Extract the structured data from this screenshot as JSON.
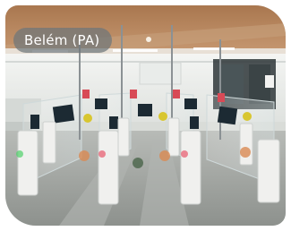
{
  "photo": {
    "location_label": "Belém (PA)",
    "scene_icon": "airport-egates-photo"
  },
  "colors": {
    "ceiling_wood": "#b88660",
    "wall": "#eef0ef",
    "floor": "#9fa3a0",
    "gate_post": "#ececea",
    "screen": "#1c2a33",
    "sign_red": "#d84a56",
    "sign_yellow": "#d8c630",
    "floor_marker_orange": "#d98a52",
    "pill_bg": "#6e767a"
  }
}
